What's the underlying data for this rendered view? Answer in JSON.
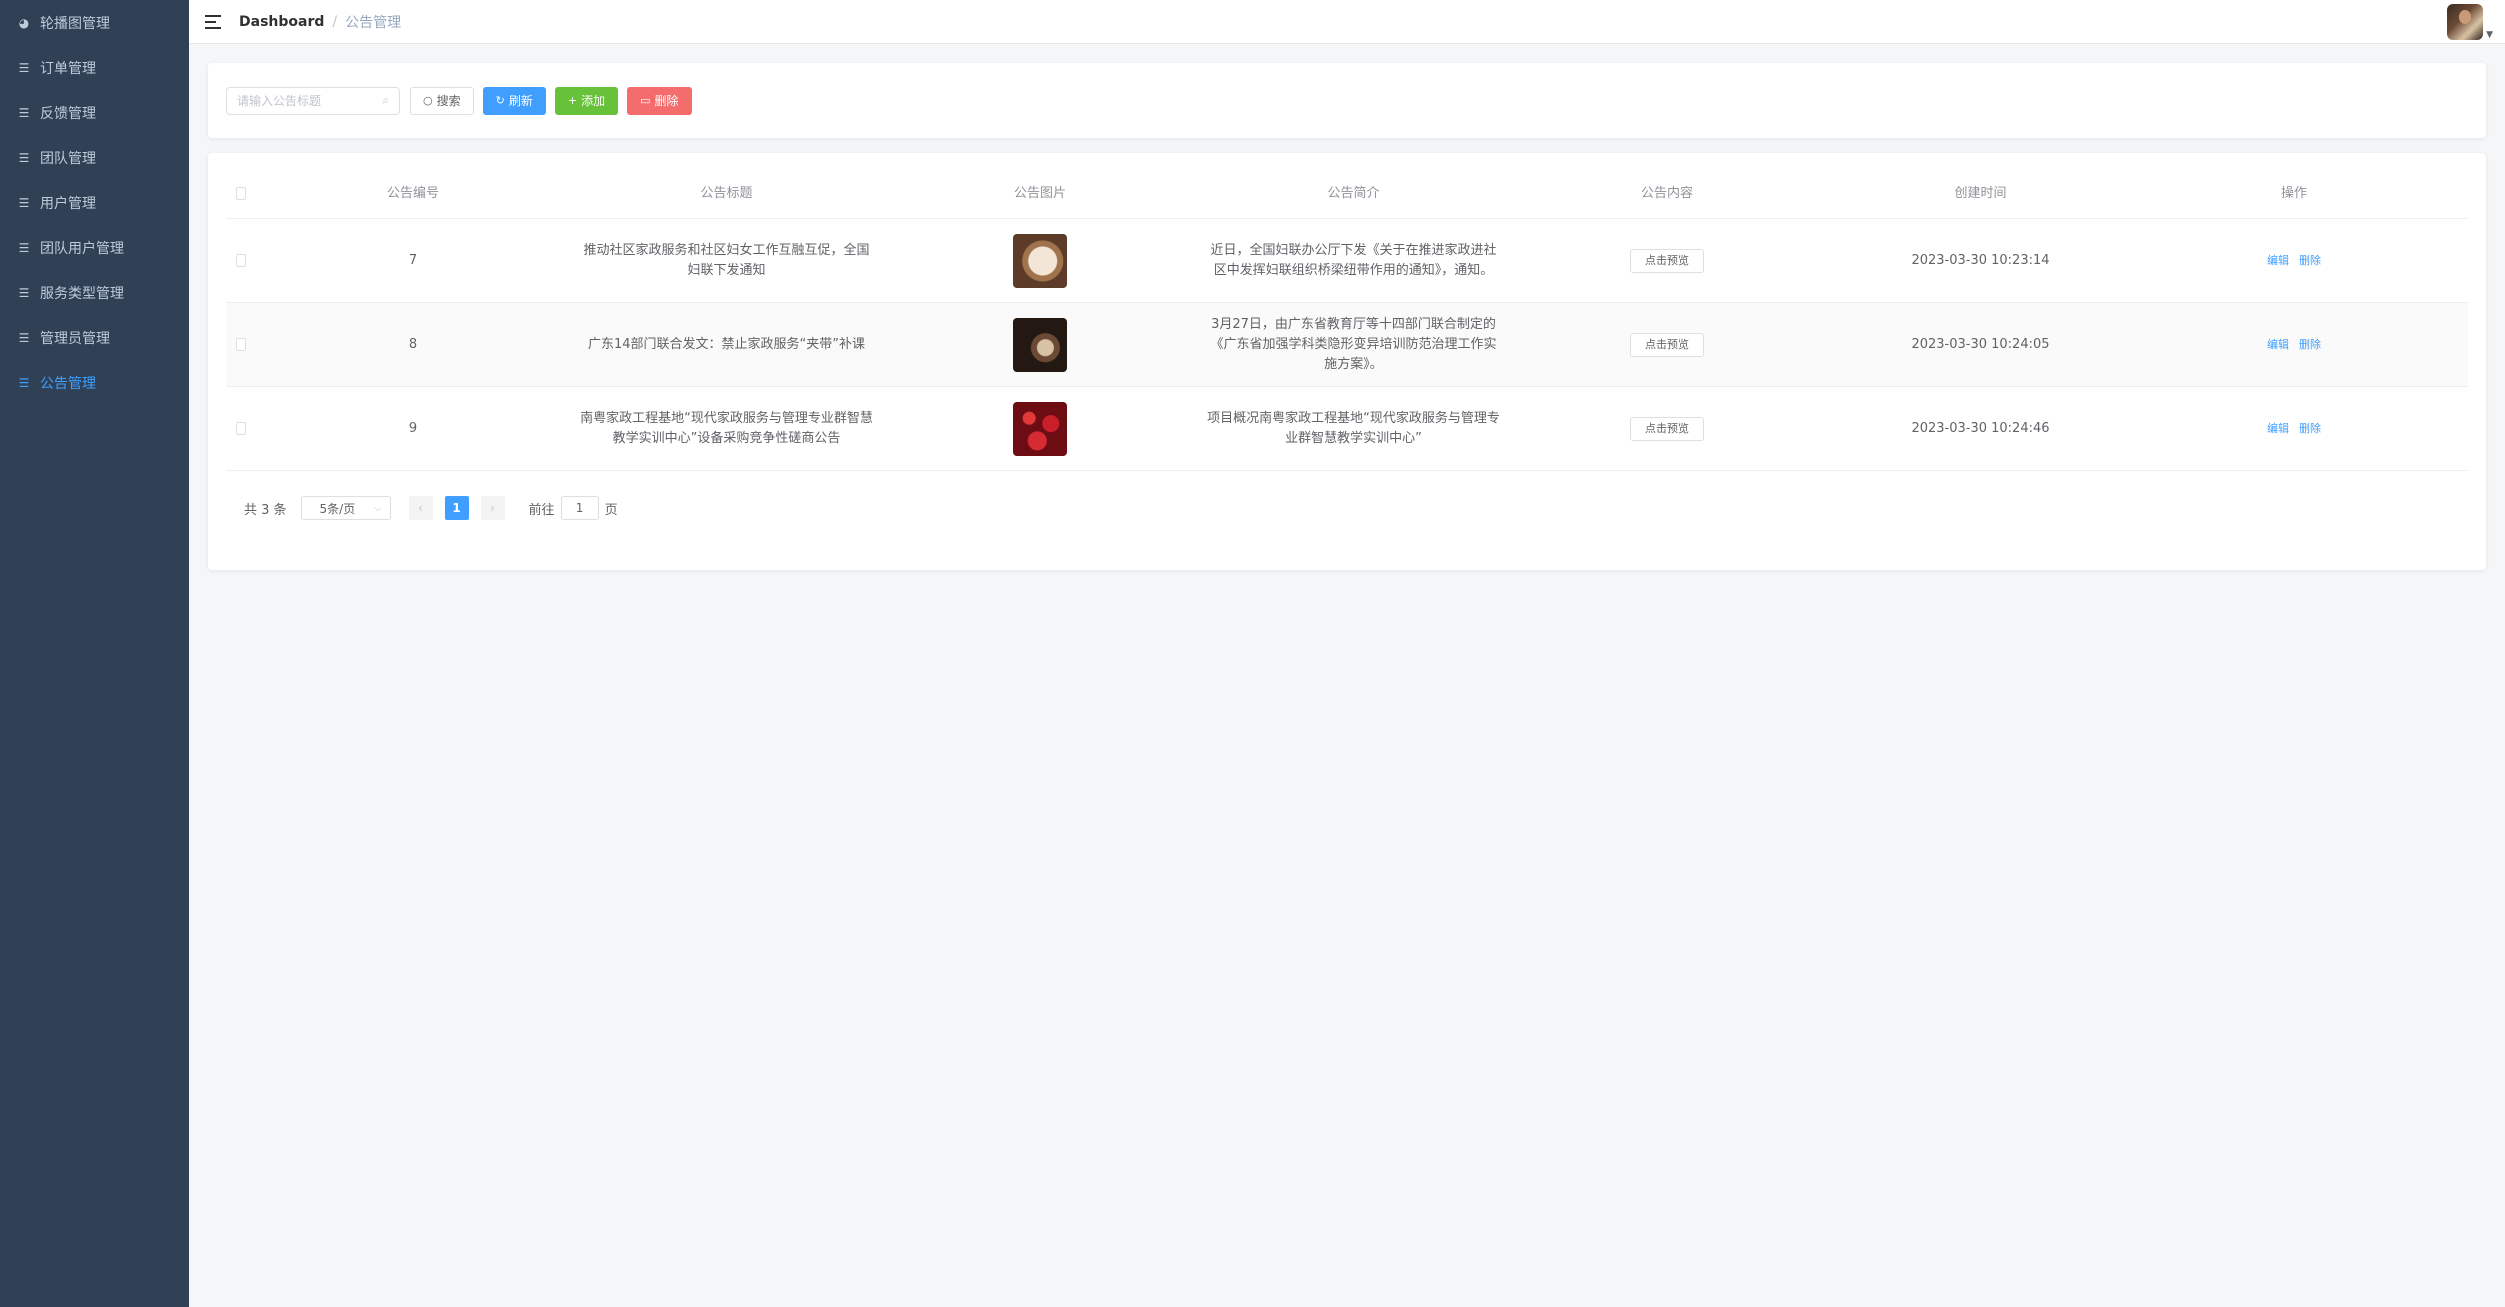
{
  "sidebar": {
    "items": [
      {
        "label": "轮播图管理",
        "icon": "dashboard-icon",
        "active": false
      },
      {
        "label": "订单管理",
        "icon": "sliders-icon",
        "active": false
      },
      {
        "label": "反馈管理",
        "icon": "sliders-icon",
        "active": false
      },
      {
        "label": "团队管理",
        "icon": "sliders-icon",
        "active": false
      },
      {
        "label": "用户管理",
        "icon": "sliders-icon",
        "active": false
      },
      {
        "label": "团队用户管理",
        "icon": "sliders-icon",
        "active": false
      },
      {
        "label": "服务类型管理",
        "icon": "sliders-icon",
        "active": false
      },
      {
        "label": "管理员管理",
        "icon": "sliders-icon",
        "active": false
      },
      {
        "label": "公告管理",
        "icon": "sliders-icon",
        "active": true
      }
    ],
    "bg_color": "#304156",
    "text_color": "#bfcbd9",
    "active_color": "#409eff"
  },
  "header": {
    "breadcrumb": {
      "home": "Dashboard",
      "separator": "/",
      "current": "公告管理"
    }
  },
  "search": {
    "placeholder": "请输入公告标题",
    "value": "",
    "buttons": {
      "search": "搜索",
      "refresh": "刷新",
      "add": "添加",
      "delete": "删除"
    }
  },
  "table": {
    "headers": {
      "id": "公告编号",
      "title": "公告标题",
      "image": "公告图片",
      "brief": "公告简介",
      "content": "公告内容",
      "time": "创建时间",
      "op": "操作"
    },
    "rows": [
      {
        "id": "7",
        "title": "推动社区家政服务和社区妇女工作互融互促，全国妇联下发通知",
        "brief": "近日，全国妇联办公厅下发《关于在推进家政进社区中发挥妇联组织桥梁纽带作用的通知》，通知。",
        "preview": "点击预览",
        "time": "2023-03-30 10:23:14",
        "edit": "编辑",
        "delete": "删除"
      },
      {
        "id": "8",
        "title": "广东14部门联合发文：禁止家政服务“夹带”补课",
        "brief": "3月27日，由广东省教育厅等十四部门联合制定的《广东省加强学科类隐形变异培训防范治理工作实施方案》。",
        "preview": "点击预览",
        "time": "2023-03-30 10:24:05",
        "edit": "编辑",
        "delete": "删除"
      },
      {
        "id": "9",
        "title": "南粤家政工程基地“现代家政服务与管理专业群智慧教学实训中心”设备采购竞争性磋商公告",
        "brief": "项目概况南粤家政工程基地“现代家政服务与管理专业群智慧教学实训中心”",
        "preview": "点击预览",
        "time": "2023-03-30 10:24:46",
        "edit": "编辑",
        "delete": "删除"
      }
    ]
  },
  "pagination": {
    "total": "共 3 条",
    "page_size": "5条/页",
    "prev": "‹",
    "next": "›",
    "current": "1",
    "goto_label": "前往",
    "goto_value": "1",
    "page_unit": "页"
  }
}
